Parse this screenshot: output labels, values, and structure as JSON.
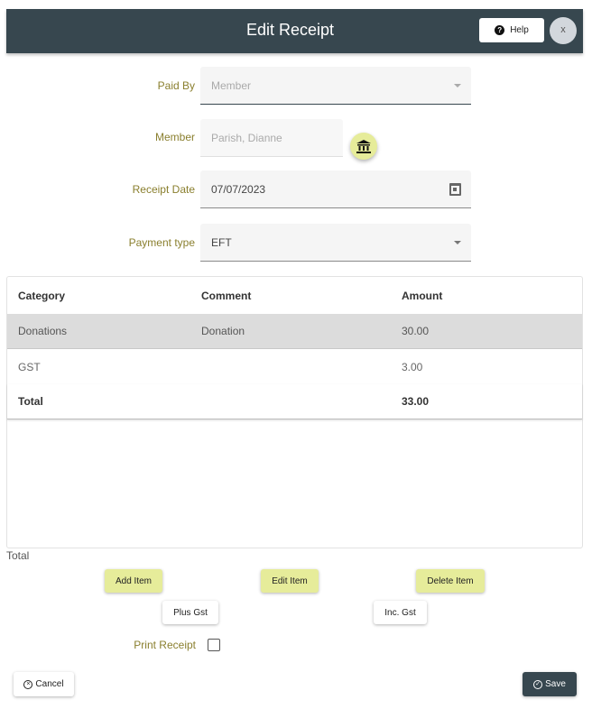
{
  "header": {
    "title": "Edit Receipt",
    "help_label": "Help",
    "help_icon": "question-circle-icon",
    "close_label": "x"
  },
  "form": {
    "paid_by": {
      "label": "Paid By",
      "value": "Member",
      "disabled": true
    },
    "member": {
      "label": "Member",
      "value": "Parish, Dianne",
      "disabled": true,
      "lookup_icon": "bank-icon"
    },
    "receipt_date": {
      "label": "Receipt Date",
      "value": "07/07/2023",
      "icon": "calendar-icon"
    },
    "payment_type": {
      "label": "Payment type",
      "value": "EFT"
    }
  },
  "table": {
    "columns": [
      "Category",
      "Comment",
      "Amount"
    ],
    "rows": [
      {
        "category": "Donations",
        "comment": "Donation",
        "amount": "30.00",
        "selected": true
      },
      {
        "category": "GST",
        "comment": "",
        "amount": "3.00",
        "selected": false
      }
    ],
    "total": {
      "label": "Total",
      "amount": "33.00"
    }
  },
  "total_caption": "Total",
  "actions": {
    "add_item": "Add Item",
    "edit_item": "Edit Item",
    "delete_item": "Delete Item",
    "plus_gst": "Plus Gst",
    "inc_gst": "Inc. Gst"
  },
  "print_receipt": {
    "label": "Print Receipt",
    "checked": false
  },
  "footer": {
    "cancel_label": "Cancel",
    "cancel_icon": "cancel-circle-icon",
    "save_label": "Save",
    "save_icon": "check-circle-icon"
  },
  "colors": {
    "header_bg": "#37474f",
    "accent_lime": "#e6ec9a",
    "label_olive": "#8a7f2e",
    "selected_row": "#dcdcdc"
  }
}
